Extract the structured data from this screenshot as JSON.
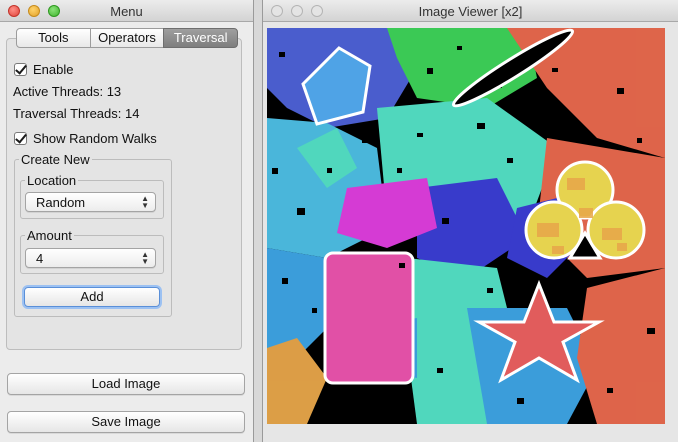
{
  "menu_window": {
    "title": "Menu",
    "tabs": [
      {
        "label": "Tools"
      },
      {
        "label": "Operators"
      },
      {
        "label": "Traversal"
      }
    ],
    "enable": {
      "label": "Enable",
      "checked": true
    },
    "active_threads": "Active Threads: 13",
    "traversal_threads": "Traversal Threads: 14",
    "show_random_walks": {
      "label": "Show Random Walks",
      "checked": true
    },
    "create_new": {
      "title": "Create New",
      "location": {
        "label": "Location",
        "value": "Random"
      },
      "amount": {
        "label": "Amount",
        "value": "4"
      },
      "add_button": "Add"
    },
    "load_image_button": "Load Image",
    "save_image_button": "Save Image"
  },
  "viewer_window": {
    "title": "Image Viewer [x2]",
    "shapes": [
      "pentagon",
      "leaf",
      "club",
      "card",
      "star"
    ],
    "colors": {
      "pentagon": "#4fa3e6",
      "leaf": "#000000",
      "club": "#e6d34f",
      "card": "#e150a6",
      "star": "#e15c5c"
    }
  }
}
